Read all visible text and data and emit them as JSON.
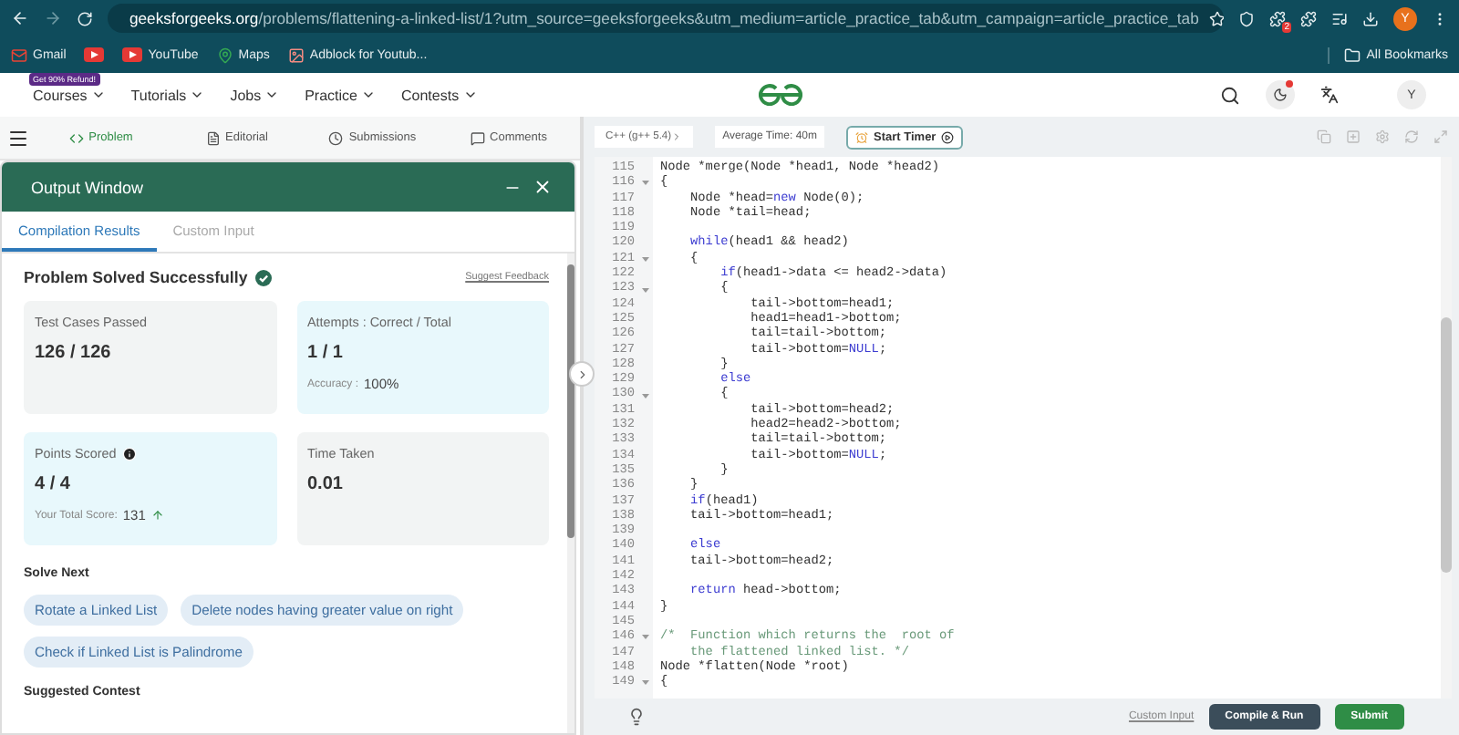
{
  "browser": {
    "url_host": "geeksforgeeks.org",
    "url_path": "/problems/flattening-a-linked-list/1?utm_source=geeksforgeeks&utm_medium=article_practice_tab&utm_campaign=article_practice_tab",
    "extension_badge": "2",
    "profile_initial": "Y"
  },
  "bookmarks": [
    {
      "kind": "gmail",
      "label": "Gmail"
    },
    {
      "kind": "youtube"
    },
    {
      "kind": "youtube",
      "label": "YouTube"
    },
    {
      "kind": "maps",
      "label": "Maps"
    },
    {
      "kind": "extension",
      "label": "Adblock for Youtub..."
    }
  ],
  "all_bookmarks": "All Bookmarks",
  "nav": {
    "promo_badge": "Get 90% Refund!",
    "menus": [
      "Courses",
      "Tutorials",
      "Jobs",
      "Practice",
      "Contests"
    ],
    "avatar": "Y"
  },
  "problem_tabs": [
    {
      "kind": "code",
      "label": "Problem",
      "selected": true
    },
    {
      "kind": "doc",
      "label": "Editorial",
      "selected": false
    },
    {
      "kind": "clock",
      "label": "Submissions",
      "selected": false
    },
    {
      "kind": "chat",
      "label": "Comments",
      "selected": false
    }
  ],
  "editor_toolbar": {
    "language": "C++ (g++ 5.4)",
    "average_time": "Average Time: 40m",
    "timer_button": "Start Timer"
  },
  "output_window": {
    "title": "Output Window",
    "tabs": [
      {
        "label": "Compilation Results",
        "selected": true
      },
      {
        "label": "Custom Input",
        "selected": false
      }
    ],
    "status": "Problem Solved Successfully",
    "feedback_link": "Suggest Feedback",
    "cards": [
      {
        "title": "Test Cases Passed",
        "info": false,
        "value": "126 / 126",
        "color": "#f2f4f4"
      },
      {
        "title": "Attempts : Correct / Total",
        "info": false,
        "value": "1 / 1",
        "note_label": "Accuracy :",
        "note_value": "100%",
        "trend_up": false,
        "color": "#e8f8fc"
      },
      {
        "title": "Points Scored",
        "info": true,
        "value": "4 / 4",
        "note_label": "Your Total Score:",
        "note_value": "131",
        "trend_up": true,
        "color": "#e8f8fc"
      },
      {
        "title": "Time Taken",
        "info": false,
        "value": "0.01",
        "color": "#f2f4f4"
      }
    ],
    "solve_next_heading": "Solve Next",
    "solve_next": [
      "Rotate a Linked List",
      "Delete nodes having greater value on right",
      "Check if Linked List is Palindrome"
    ],
    "suggested_heading": "Suggested Contest"
  },
  "code": {
    "lines": [
      {
        "number": "115",
        "fold": false,
        "tokens": [
          {
            "kind": "plain",
            "text": "Node *merge(Node *head1, Node *head2)"
          }
        ]
      },
      {
        "number": "116",
        "fold": true,
        "tokens": [
          {
            "kind": "plain",
            "text": "{"
          }
        ]
      },
      {
        "number": "117",
        "fold": false,
        "tokens": [
          {
            "kind": "plain",
            "text": "    Node *head="
          },
          {
            "kind": "keyword",
            "text": "new"
          },
          {
            "kind": "plain",
            "text": " Node(0);"
          }
        ]
      },
      {
        "number": "118",
        "fold": false,
        "tokens": [
          {
            "kind": "plain",
            "text": "    Node *tail=head;"
          }
        ]
      },
      {
        "number": "119",
        "fold": false
      },
      {
        "number": "120",
        "fold": false,
        "tokens": [
          {
            "kind": "keyword",
            "text": "    while"
          },
          {
            "kind": "plain",
            "text": "(head1 && head2)"
          }
        ]
      },
      {
        "number": "121",
        "fold": true,
        "tokens": [
          {
            "kind": "plain",
            "text": "    {"
          }
        ]
      },
      {
        "number": "122",
        "fold": false,
        "tokens": [
          {
            "kind": "keyword",
            "text": "        if"
          },
          {
            "kind": "plain",
            "text": "(head1->data <= head2->data)"
          }
        ]
      },
      {
        "number": "123",
        "fold": true,
        "tokens": [
          {
            "kind": "plain",
            "text": "        {"
          }
        ]
      },
      {
        "number": "124",
        "fold": false,
        "tokens": [
          {
            "kind": "plain",
            "text": "            tail->bottom=head1;"
          }
        ]
      },
      {
        "number": "125",
        "fold": false,
        "tokens": [
          {
            "kind": "plain",
            "text": "            head1=head1->bottom;"
          }
        ]
      },
      {
        "number": "126",
        "fold": false,
        "tokens": [
          {
            "kind": "plain",
            "text": "            tail=tail->bottom;"
          }
        ]
      },
      {
        "number": "127",
        "fold": false,
        "tokens": [
          {
            "kind": "plain",
            "text": "            tail->bottom="
          },
          {
            "kind": "keyword",
            "text": "NULL"
          },
          {
            "kind": "plain",
            "text": ";"
          }
        ]
      },
      {
        "number": "128",
        "fold": false,
        "tokens": [
          {
            "kind": "plain",
            "text": "        }"
          }
        ]
      },
      {
        "number": "129",
        "fold": false,
        "tokens": [
          {
            "kind": "keyword",
            "text": "        else"
          }
        ]
      },
      {
        "number": "130",
        "fold": true,
        "tokens": [
          {
            "kind": "plain",
            "text": "        {"
          }
        ]
      },
      {
        "number": "131",
        "fold": false,
        "tokens": [
          {
            "kind": "plain",
            "text": "            tail->bottom=head2;"
          }
        ]
      },
      {
        "number": "132",
        "fold": false,
        "tokens": [
          {
            "kind": "plain",
            "text": "            head2=head2->bottom;"
          }
        ]
      },
      {
        "number": "133",
        "fold": false,
        "tokens": [
          {
            "kind": "plain",
            "text": "            tail=tail->bottom;"
          }
        ]
      },
      {
        "number": "134",
        "fold": false,
        "tokens": [
          {
            "kind": "plain",
            "text": "            tail->bottom="
          },
          {
            "kind": "keyword",
            "text": "NULL"
          },
          {
            "kind": "plain",
            "text": ";"
          }
        ]
      },
      {
        "number": "135",
        "fold": false,
        "tokens": [
          {
            "kind": "plain",
            "text": "        }"
          }
        ]
      },
      {
        "number": "136",
        "fold": false,
        "tokens": [
          {
            "kind": "plain",
            "text": "    }"
          }
        ]
      },
      {
        "number": "137",
        "fold": false,
        "tokens": [
          {
            "kind": "keyword",
            "text": "    if"
          },
          {
            "kind": "plain",
            "text": "(head1)"
          }
        ]
      },
      {
        "number": "138",
        "fold": false,
        "tokens": [
          {
            "kind": "plain",
            "text": "    tail->bottom=head1;"
          }
        ]
      },
      {
        "number": "139",
        "fold": false
      },
      {
        "number": "140",
        "fold": false,
        "tokens": [
          {
            "kind": "keyword",
            "text": "    else"
          }
        ]
      },
      {
        "number": "141",
        "fold": false,
        "tokens": [
          {
            "kind": "plain",
            "text": "    tail->bottom=head2;"
          }
        ]
      },
      {
        "number": "142",
        "fold": false
      },
      {
        "number": "143",
        "fold": false,
        "tokens": [
          {
            "kind": "keyword",
            "text": "    return"
          },
          {
            "kind": "plain",
            "text": " head->bottom;"
          }
        ]
      },
      {
        "number": "144",
        "fold": false,
        "tokens": [
          {
            "kind": "plain",
            "text": "}"
          }
        ]
      },
      {
        "number": "145",
        "fold": false
      },
      {
        "number": "146",
        "fold": true,
        "tokens": [
          {
            "kind": "comment",
            "text": "/*  Function which returns the  root of"
          }
        ]
      },
      {
        "number": "147",
        "fold": false,
        "tokens": [
          {
            "kind": "comment",
            "text": "    the flattened linked list. */"
          }
        ]
      },
      {
        "number": "148",
        "fold": false,
        "tokens": [
          {
            "kind": "plain",
            "text": "Node *flatten(Node *root)"
          }
        ]
      },
      {
        "number": "149",
        "fold": true,
        "tokens": [
          {
            "kind": "plain",
            "text": "{"
          }
        ]
      }
    ]
  },
  "bottom_bar": {
    "custom_input": "Custom Input",
    "compile": "Compile & Run",
    "submit": "Submit"
  }
}
